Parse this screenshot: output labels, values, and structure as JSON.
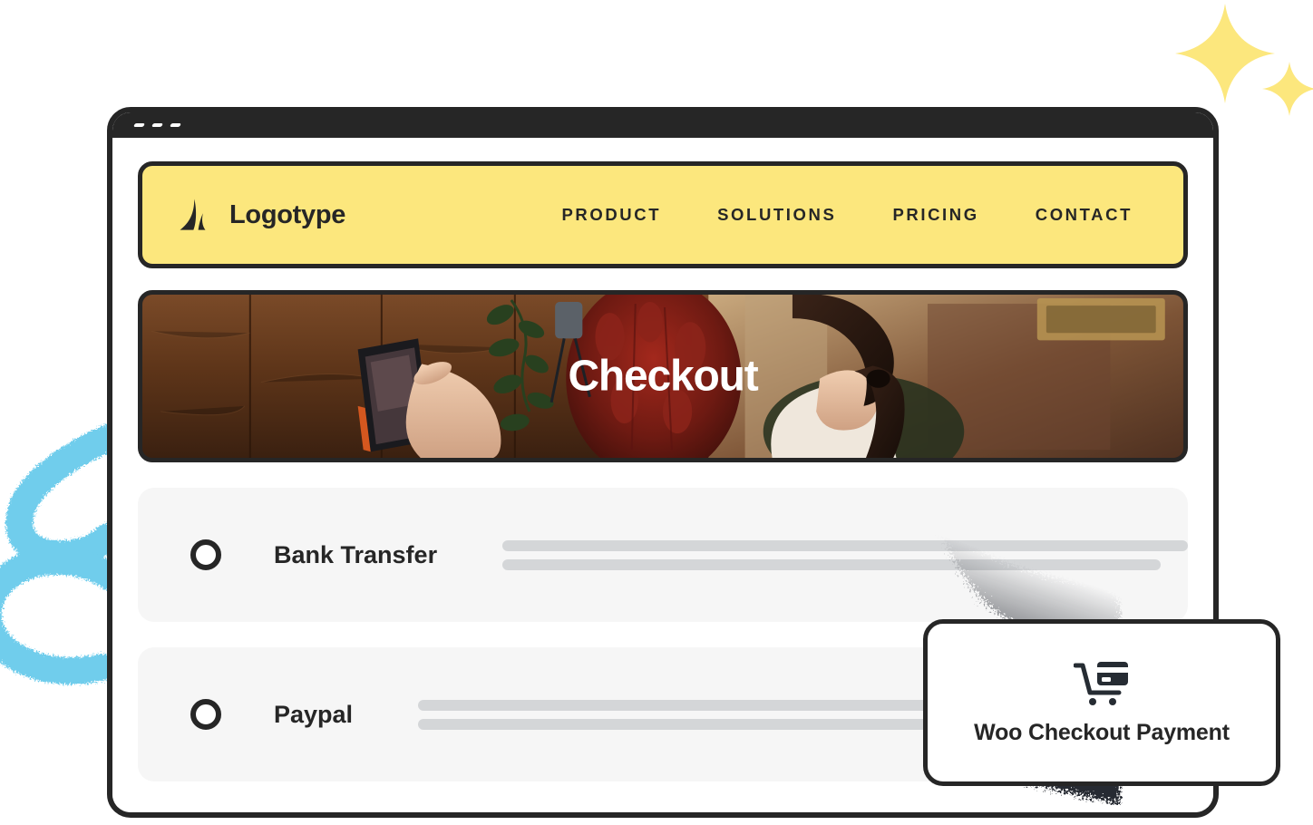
{
  "window": {
    "chrome_dots": [
      "dash-1",
      "dash-2",
      "dash-3"
    ]
  },
  "navbar": {
    "logo_icon": "logo-mark-a",
    "brand_name": "Logotype",
    "links": [
      {
        "label": "PRODUCT"
      },
      {
        "label": "SOLUTIONS"
      },
      {
        "label": "PRICING"
      },
      {
        "label": "CONTACT"
      }
    ]
  },
  "hero": {
    "title": "Checkout",
    "image_description": "woman pointing at a tablet point-of-sale device on a dark wooden wall with plants and dried red flowers"
  },
  "payment_options": [
    {
      "radio_icon": "radio-unchecked-icon",
      "label": "Bank Transfer",
      "selected": false,
      "bars": [
        100,
        96
      ]
    },
    {
      "radio_icon": "radio-unchecked-icon",
      "label": "Paypal",
      "selected": false,
      "bars": [
        100,
        71
      ]
    }
  ],
  "float_card": {
    "icon": "shopping-cart-card-icon",
    "label": "Woo Checkout Payment"
  },
  "decorations": {
    "sparkle_large": "sparkle-icon",
    "sparkle_small": "sparkle-icon",
    "squiggle": "blue-brush-squiggle",
    "dispersion": "particle-dispersion-effect"
  },
  "colors": {
    "accent_yellow": "#FCE77D",
    "dark": "#262626",
    "panel_gray": "#F6F6F6",
    "bar_gray": "#D4D6D8",
    "squiggle_blue": "#6FCDEC"
  }
}
